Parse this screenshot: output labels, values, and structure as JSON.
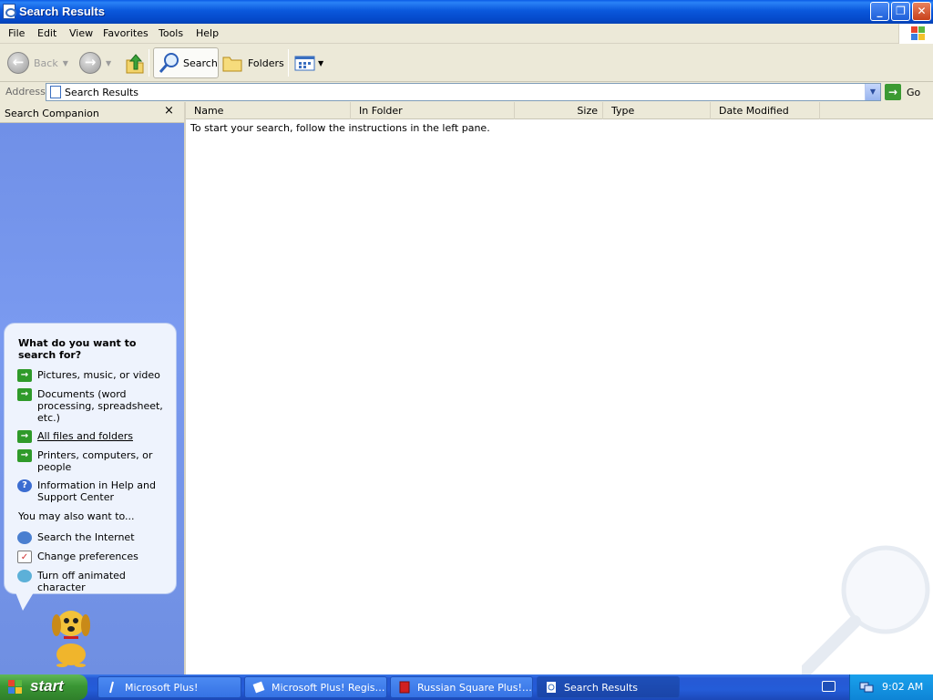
{
  "window": {
    "title": "Search Results"
  },
  "menu": [
    "File",
    "Edit",
    "View",
    "Favorites",
    "Tools",
    "Help"
  ],
  "toolbar": {
    "back_label": "Back",
    "search_label": "Search",
    "folders_label": "Folders"
  },
  "address": {
    "label": "Address",
    "value": "Search Results",
    "go_label": "Go"
  },
  "search_companion": {
    "title": "Search Companion",
    "close": "×",
    "question": "What do you want to search for?",
    "options": [
      "Pictures, music, or video",
      "Documents (word processing, spreadsheet, etc.)",
      "All files and folders",
      "Printers, computers, or people",
      "Information in Help and Support Center"
    ],
    "also_want": "You may also want to...",
    "also_options": [
      "Search the Internet",
      "Change preferences",
      "Turn off animated character"
    ]
  },
  "results": {
    "columns": [
      "Name",
      "In Folder",
      "Size",
      "Type",
      "Date Modified"
    ],
    "empty_message": "To start your search, follow the instructions in the left pane."
  },
  "taskbar": {
    "start_label": "start",
    "tasks": [
      "Microsoft Plus!",
      "Microsoft Plus! Regist...",
      "Russian Square Plus! ...",
      "Search Results"
    ],
    "clock": "9:02 AM"
  },
  "colors": {
    "title_bar": "#0a58dc",
    "side_pane": "#7a9af0",
    "taskbar": "#245cd8",
    "start_button": "#3a9634"
  },
  "icons": [
    "page-icon",
    "back-arrow-icon",
    "forward-arrow-icon",
    "folder-up-icon",
    "search-magnifier-icon",
    "folder-icon",
    "views-icon",
    "go-arrow-icon",
    "green-arrow-icon",
    "help-icon",
    "globe-icon",
    "preferences-icon",
    "dog-character-icon",
    "keyboard-icon",
    "network-icon",
    "windows-logo-icon"
  ]
}
